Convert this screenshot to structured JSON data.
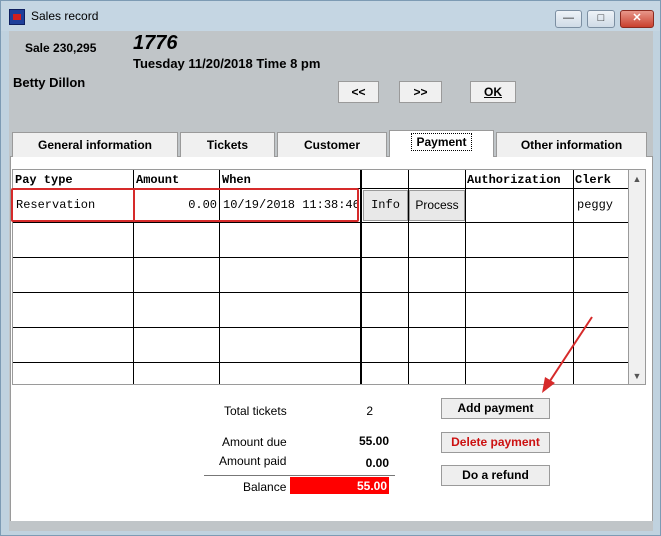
{
  "window": {
    "title": "Sales record"
  },
  "sale": {
    "number_label": "Sale 230,295",
    "big_number": "1776",
    "datetime": "Tuesday 11/20/2018  Time 8 pm",
    "customer": "Betty Dillon"
  },
  "nav": {
    "prev": "<<",
    "next": ">>",
    "ok": "OK"
  },
  "tabs": [
    "General information",
    "Tickets",
    "Customer",
    "Payment",
    "Other information"
  ],
  "active_tab": "Payment",
  "grid": {
    "headers": {
      "pay_type": "Pay type",
      "amount": "Amount",
      "when": "When",
      "authorization": "Authorization",
      "clerk": "Clerk"
    },
    "rows": [
      {
        "pay_type": "Reservation",
        "amount": "0.00",
        "when": "10/19/2018 11:38:46",
        "info": "Info",
        "process": "Process",
        "authorization": "",
        "clerk": "peggy"
      }
    ]
  },
  "totals": {
    "tickets_label": "Total tickets",
    "tickets_value": "2",
    "due_label": "Amount due",
    "due_value": "55.00",
    "paid_label": "Amount paid",
    "paid_value": "0.00",
    "balance_label": "Balance",
    "balance_value": "55.00"
  },
  "actions": {
    "add": "Add payment",
    "delete": "Delete payment",
    "refund": "Do a refund"
  },
  "colors": {
    "highlight": "#ff0000",
    "annotation": "#d62a2a",
    "delete_text": "#cc1111"
  }
}
